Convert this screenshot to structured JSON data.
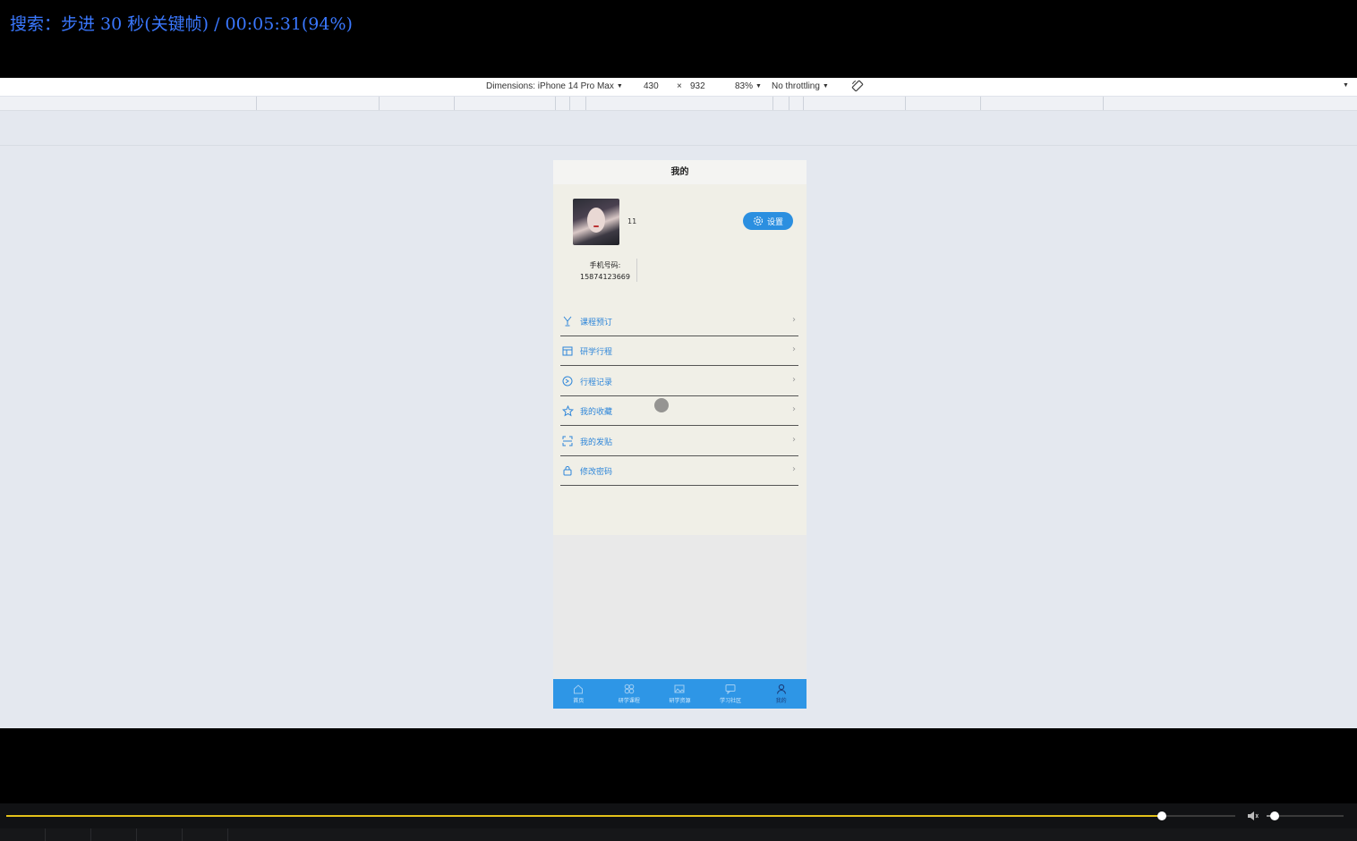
{
  "player": {
    "osd_text": "搜索：步进 30 秒(关键帧) / 00:05:31(94%)",
    "progress": 0.94,
    "volume": 0.1,
    "accent_color": "#e3c21a"
  },
  "devtools": {
    "dimensions_label": "Dimensions: iPhone 14 Pro Max",
    "width": "430",
    "times": "×",
    "height": "932",
    "zoom": "83%",
    "throttling": "No throttling"
  },
  "app": {
    "title": "我的",
    "profile": {
      "username": "11",
      "settings_label": "设置",
      "phone_label": "手机号码:",
      "phone_value": "15874123669"
    },
    "menu": [
      {
        "label": "课程预订",
        "icon": "trophy-icon"
      },
      {
        "label": "研学行程",
        "icon": "calendar-icon"
      },
      {
        "label": "行程记录",
        "icon": "record-icon"
      },
      {
        "label": "我的收藏",
        "icon": "star-icon"
      },
      {
        "label": "我的发贴",
        "icon": "post-icon"
      },
      {
        "label": "修改密码",
        "icon": "lock-icon"
      }
    ],
    "tabs": [
      {
        "label": "首页",
        "icon": "home-icon"
      },
      {
        "label": "研学课程",
        "icon": "grid-icon"
      },
      {
        "label": "研学资源",
        "icon": "resource-icon"
      },
      {
        "label": "学习社区",
        "icon": "chat-icon"
      },
      {
        "label": "我的",
        "icon": "user-icon"
      }
    ],
    "colors": {
      "primary": "#2e96e6",
      "menu_text": "#2e86d9",
      "active_tab": "#1b3d7a"
    }
  }
}
